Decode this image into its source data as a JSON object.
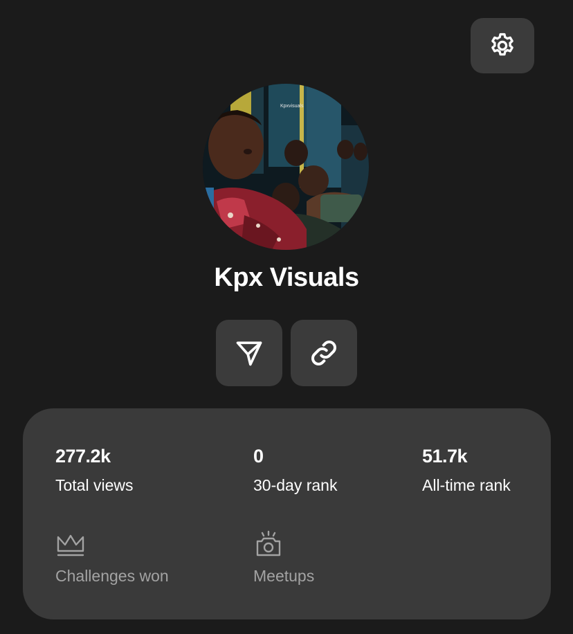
{
  "header": {
    "settings_icon": "gear-icon"
  },
  "profile": {
    "name": "Kpx Visuals",
    "avatar_caption": "Kpxvisuals"
  },
  "actions": {
    "share_icon": "send-icon",
    "link_icon": "link-icon"
  },
  "stats": {
    "total_views": {
      "value": "277.2k",
      "label": "Total views"
    },
    "rank_30_day": {
      "value": "0",
      "label": "30-day rank"
    },
    "rank_all_time": {
      "value": "51.7k",
      "label": "All-time rank"
    },
    "challenges_won": {
      "icon": "crown-icon",
      "label": "Challenges won"
    },
    "meetups": {
      "icon": "camera-flash-icon",
      "label": "Meetups"
    }
  },
  "colors": {
    "background": "#1b1b1b",
    "card": "#3a3a3a",
    "button": "#3b3b3b",
    "muted_text": "#a3a3a3"
  }
}
